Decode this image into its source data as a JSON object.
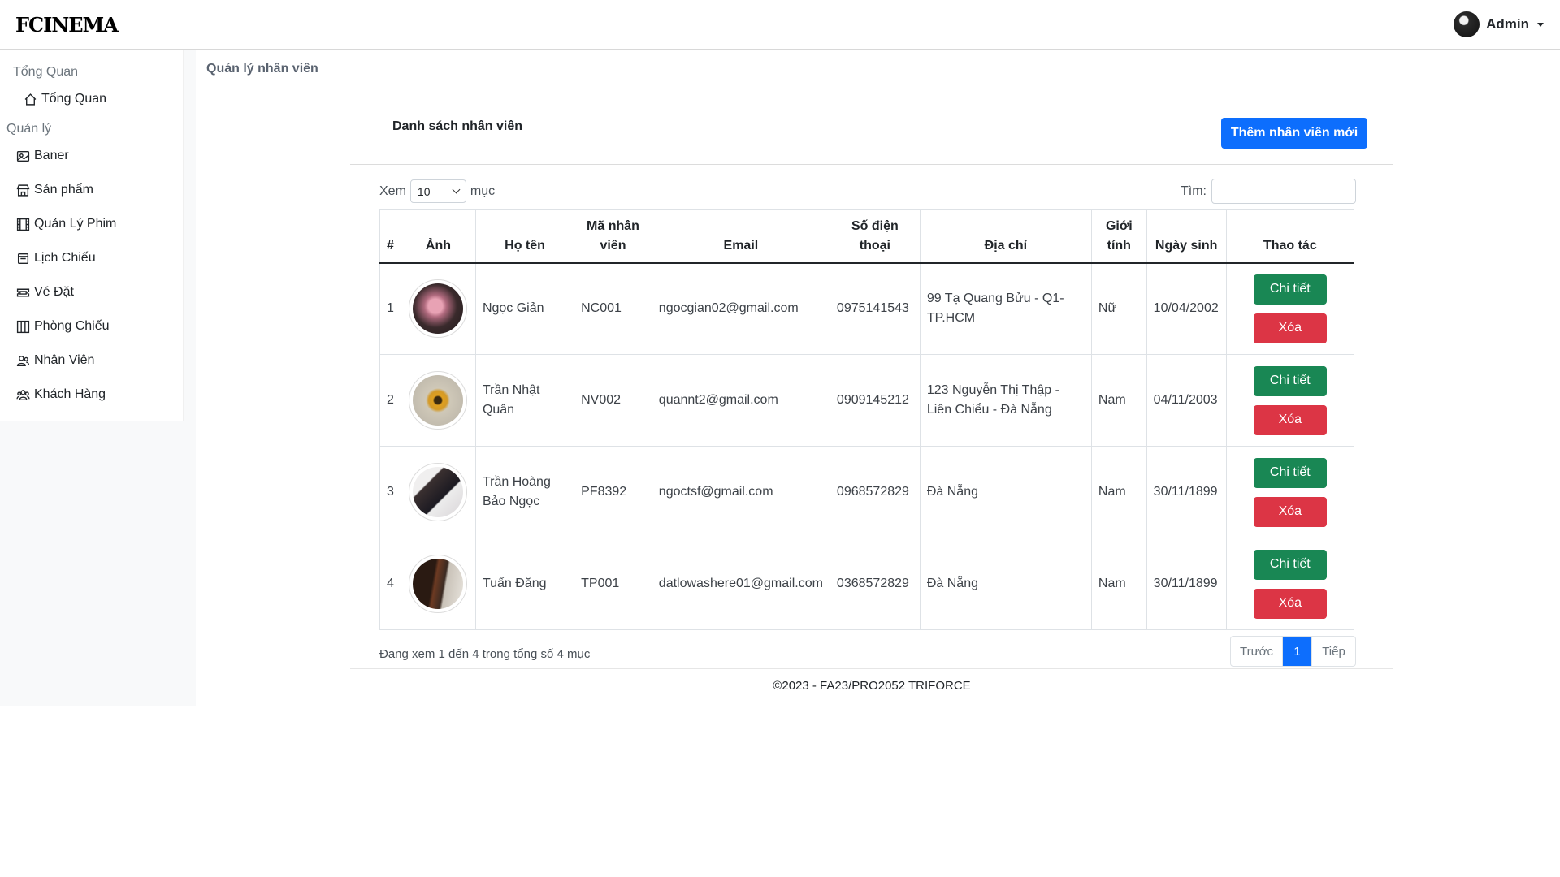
{
  "header": {
    "brand": "FCINEMA",
    "user_label": "Admin"
  },
  "sidebar": {
    "section_overview": "Tổng Quan",
    "overview_item": "Tổng Quan",
    "section_manage": "Quản lý",
    "items": [
      {
        "label": "Baner",
        "icon": "banner-icon"
      },
      {
        "label": "Sản phẩm",
        "icon": "store-icon"
      },
      {
        "label": "Quản Lý Phim",
        "icon": "film-icon"
      },
      {
        "label": "Lịch Chiếu",
        "icon": "calendar-icon"
      },
      {
        "label": "Vé Đặt",
        "icon": "ticket-icon"
      },
      {
        "label": "Phòng Chiếu",
        "icon": "columns-icon"
      },
      {
        "label": "Nhân Viên",
        "icon": "people-icon"
      },
      {
        "label": "Khách Hàng",
        "icon": "users-icon"
      }
    ]
  },
  "main": {
    "breadcrumb": "Quản lý nhân viên",
    "card_title": "Danh sách nhân viên",
    "add_button": "Thêm nhân viên mới",
    "length": {
      "prefix": "Xem",
      "value": "10",
      "suffix": "mục"
    },
    "search": {
      "label": "Tìm:",
      "value": ""
    },
    "columns": [
      "#",
      "Ảnh",
      "Họ tên",
      "Mã nhân viên",
      "Email",
      "Số điện thoại",
      "Địa chỉ",
      "Giới tính",
      "Ngày sinh",
      "Thao tác"
    ],
    "rows": [
      {
        "no": "1",
        "name": "Ngọc Giản",
        "code": "NC001",
        "email": "ngocgian02@gmail.com",
        "phone": "0975141543",
        "address": "99 Tạ Quang Bửu - Q1-TP.HCM",
        "gender": "Nữ",
        "dob": "10/04/2002"
      },
      {
        "no": "2",
        "name": "Trần Nhật Quân",
        "code": "NV002",
        "email": "quannt2@gmail.com",
        "phone": "0909145212",
        "address": "123 Nguyễn Thị Thập - Liên Chiểu - Đà Nẵng",
        "gender": "Nam",
        "dob": "04/11/2003"
      },
      {
        "no": "3",
        "name": "Trần Hoàng Bảo Ngọc",
        "code": "PF8392",
        "email": "ngoctsf@gmail.com",
        "phone": "0968572829",
        "address": "Đà Nẵng",
        "gender": "Nam",
        "dob": "30/11/1899"
      },
      {
        "no": "4",
        "name": "Tuấn Đăng",
        "code": "TP001",
        "email": "datlowashere01@gmail.com",
        "phone": "0368572829",
        "address": "Đà Nẵng",
        "gender": "Nam",
        "dob": "30/11/1899"
      }
    ],
    "detail_label": "Chi tiết",
    "delete_label": "Xóa",
    "info": "Đang xem 1 đến 4 trong tổng số 4 mục",
    "pager": {
      "prev": "Trước",
      "current": "1",
      "next": "Tiếp"
    }
  },
  "footer": "©2023 - FA23/PRO2052 TRIFORCE",
  "colors": {
    "primary": "#0d6efd",
    "success": "#198754",
    "danger": "#dc3545"
  }
}
